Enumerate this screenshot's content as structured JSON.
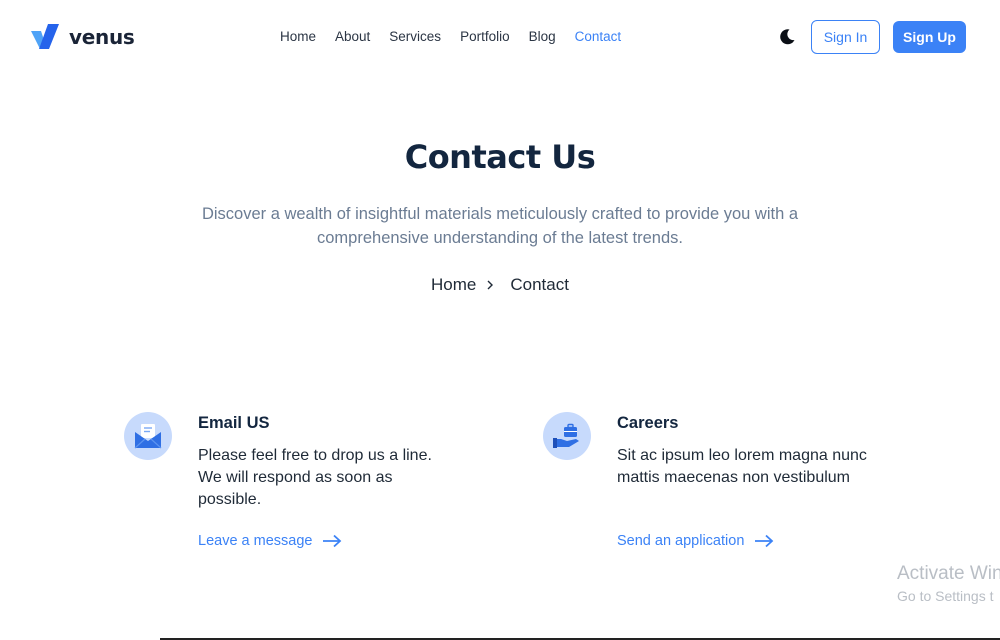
{
  "brand": {
    "name": "venus",
    "accent": "#3b82f6"
  },
  "nav": {
    "items": [
      {
        "label": "Home",
        "active": false
      },
      {
        "label": "About",
        "active": false
      },
      {
        "label": "Services",
        "active": false
      },
      {
        "label": "Portfolio",
        "active": false
      },
      {
        "label": "Blog",
        "active": false
      },
      {
        "label": "Contact",
        "active": true
      }
    ]
  },
  "header": {
    "theme_toggle_icon": "moon-icon",
    "signin_label": "Sign In",
    "signup_label": "Sign Up"
  },
  "hero": {
    "title": "Contact Us",
    "subtitle": "Discover a wealth of insightful materials meticulously crafted to provide you with a comprehensive understanding of the latest trends."
  },
  "breadcrumb": {
    "home": "Home",
    "current": "Contact",
    "separator_icon": "chevron-right-icon"
  },
  "cards": [
    {
      "icon": "envelope-icon",
      "title": "Email US",
      "text": "Please feel free to drop us a line. We will respond as soon as possible.",
      "link_label": "Leave a message",
      "link_icon": "arrow-right-icon"
    },
    {
      "icon": "briefcase-hand-icon",
      "title": "Careers",
      "text": "Sit ac ipsum leo lorem magna nunc mattis maecenas non vestibulum",
      "link_label": "Send an application",
      "link_icon": "arrow-right-icon"
    }
  ],
  "watermark": {
    "line1": "Activate Win",
    "line2": "Go to Settings t"
  }
}
